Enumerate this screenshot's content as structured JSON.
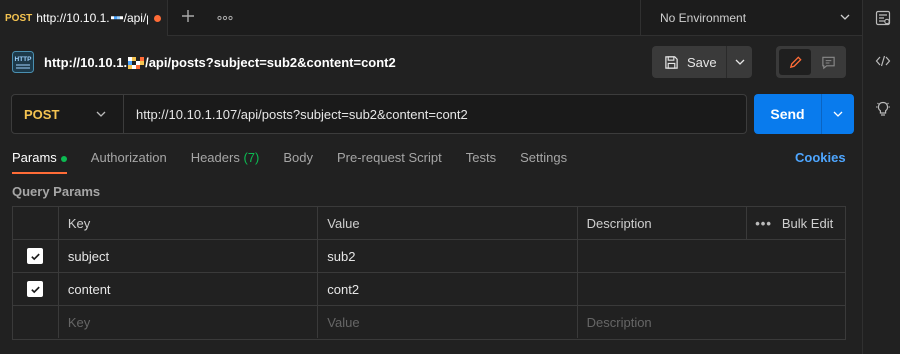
{
  "tab": {
    "method": "POST",
    "url": "http://10.10.1.",
    "url_tail": "/api/p"
  },
  "environment": {
    "label": "No Environment"
  },
  "request": {
    "title_prefix": "http://10.10.1.",
    "title_suffix": "/api/posts?subject=sub2&content=cont2",
    "method": "POST",
    "url": "http://10.10.1.107/api/posts?subject=sub2&content=cont2",
    "save_label": "Save",
    "send_label": "Send"
  },
  "subtabs": {
    "params": "Params",
    "authorization": "Authorization",
    "headers": "Headers",
    "headers_count": "(7)",
    "body": "Body",
    "prerequest": "Pre-request Script",
    "tests": "Tests",
    "settings": "Settings",
    "cookies": "Cookies"
  },
  "query_params": {
    "title": "Query Params",
    "columns": {
      "key": "Key",
      "value": "Value",
      "description": "Description",
      "bulk_edit": "Bulk Edit",
      "more": "•••"
    },
    "rows": [
      {
        "key": "subject",
        "value": "sub2",
        "description": "",
        "checked": true
      },
      {
        "key": "content",
        "value": "cont2",
        "description": "",
        "checked": true
      }
    ],
    "placeholders": {
      "key": "Key",
      "value": "Value",
      "description": "Description"
    }
  },
  "colors": {
    "accent": "#ff6c37",
    "send": "#097bed",
    "method_post": "#f5c451",
    "success": "#0cbb52",
    "link": "#4ea6ff"
  }
}
